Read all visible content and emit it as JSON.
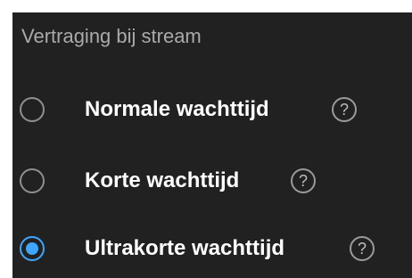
{
  "section": {
    "title": "Vertraging bij stream"
  },
  "options": [
    {
      "label": "Normale wachttijd",
      "selected": false,
      "help_icon": "?"
    },
    {
      "label": "Korte wachttijd",
      "selected": false,
      "help_icon": "?"
    },
    {
      "label": "Ultrakorte wachttijd",
      "selected": true,
      "help_icon": "?"
    }
  ],
  "colors": {
    "background": "#212121",
    "accent": "#3ea6ff",
    "title": "#aaaaaa",
    "text": "#ffffff"
  }
}
